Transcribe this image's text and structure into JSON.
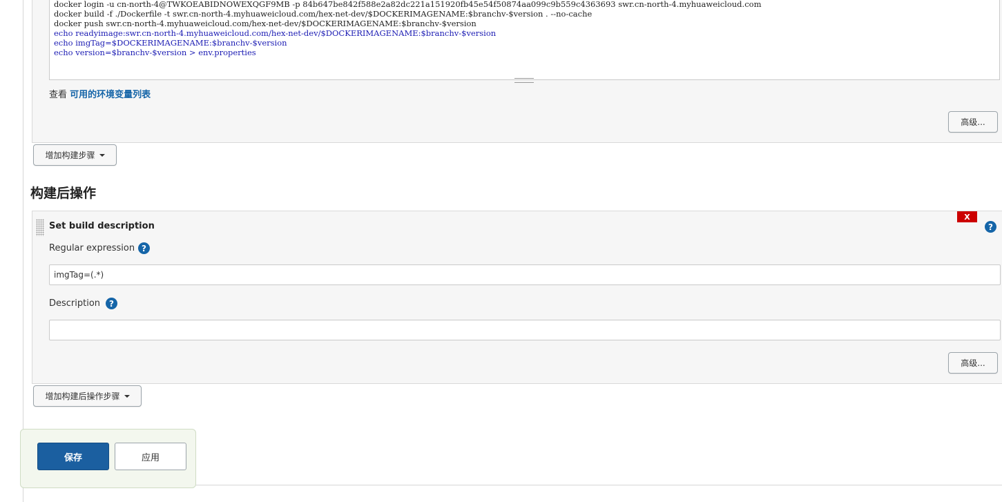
{
  "build_step": {
    "script_lines": [
      "docker login -u cn-north-4@TWKOEABIDNOWEXQGF9MB -p 84b647be842f588e2a82dc221a151920fb45e54f50874aa099c9b559c4363693 swr.cn-north-4.myhuaweicloud.com",
      "docker build -f ./Dockerfile -t swr.cn-north-4.myhuaweicloud.com/hex-net-dev/$DOCKERIMAGENAME:$branchv-$version . --no-cache",
      "docker push swr.cn-north-4.myhuaweicloud.com/hex-net-dev/$DOCKERIMAGENAME:$branchv-$version",
      "echo readyimage:swr.cn-north-4.myhuaweicloud.com/hex-net-dev/$DOCKERIMAGENAME:$branchv-$version",
      "echo imgTag=$DOCKERIMAGENAME:$branchv-$version",
      "echo version=$branchv-$version > env.properties"
    ],
    "env_prefix": "查看",
    "env_link": "可用的环境变量列表",
    "advanced_label": "高级..."
  },
  "add_build_step_label": "增加构建步骤",
  "post_build": {
    "section_title": "构建后操作",
    "step_title": "Set build description",
    "delete_label": "X",
    "help_glyph": "?",
    "regex_label": "Regular expression",
    "regex_value": "imgTag=(.*)",
    "description_label": "Description",
    "description_value": "",
    "advanced_label": "高级..."
  },
  "add_post_build_step_label": "增加构建后操作步骤",
  "footer": {
    "save_label": "保存",
    "apply_label": "应用"
  },
  "colors": {
    "primary": "#1b5fa0",
    "link": "#1565a8",
    "danger": "#cc0000"
  }
}
